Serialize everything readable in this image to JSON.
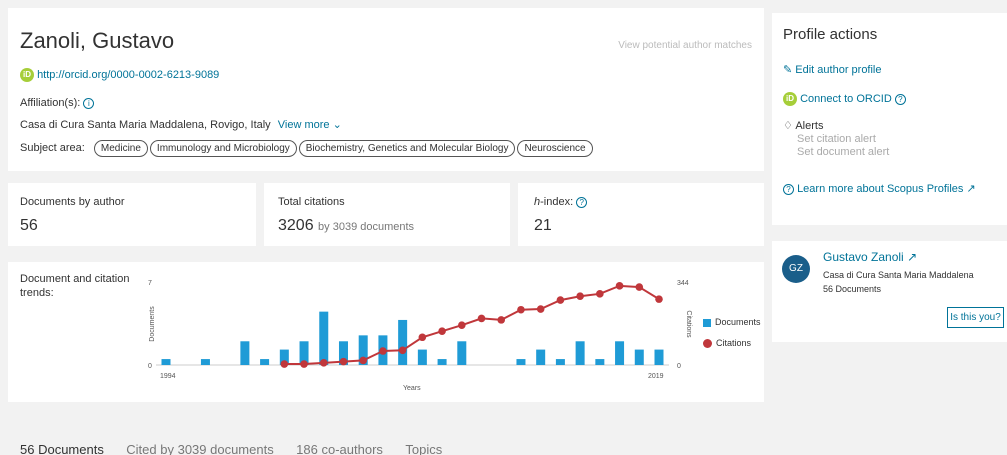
{
  "profile": {
    "name": "Zanoli, Gustavo",
    "view_matches": "View potential author matches",
    "orcid_url": "http://orcid.org/0000-0002-6213-9089",
    "affiliation_label": "Affiliation(s):",
    "affiliation": "Casa di Cura Santa Maria Maddalena, Rovigo, Italy",
    "view_more": "View more",
    "subject_label": "Subject area:",
    "subjects": [
      "Medicine",
      "Immunology and Microbiology",
      "Biochemistry, Genetics and Molecular Biology",
      "Neuroscience"
    ]
  },
  "metrics": {
    "documents_label": "Documents by author",
    "documents_value": "56",
    "citations_label": "Total citations",
    "citations_value": "3206",
    "citations_sub": "by 3039 documents",
    "hindex_label_h": "h",
    "hindex_label_rest": "-index:",
    "hindex_value": "21"
  },
  "trends": {
    "title": "Document and citation trends:",
    "legend_documents": "Documents",
    "legend_citations": "Citations",
    "color_documents": "#1f9bd6",
    "color_citations": "#c0373b"
  },
  "chart_data": {
    "type": "bar",
    "xlabel": "Years",
    "ylabel_left": "Documents",
    "ylabel_right": "Citations",
    "left_ticks": [
      "7",
      "0"
    ],
    "right_ticks": [
      "344",
      "0"
    ],
    "x_ticks": [
      "1994",
      "2019"
    ],
    "left_ylim": [
      0,
      7
    ],
    "right_ylim": [
      0,
      344
    ],
    "years": [
      1994,
      1995,
      1996,
      1997,
      1998,
      1999,
      2000,
      2001,
      2002,
      2003,
      2004,
      2005,
      2006,
      2007,
      2008,
      2009,
      2010,
      2011,
      2012,
      2013,
      2014,
      2015,
      2016,
      2017,
      2018,
      2019
    ],
    "series": [
      {
        "name": "Documents",
        "values": [
          0.5,
          0,
          0.5,
          0,
          2,
          0.5,
          1.3,
          2,
          4.5,
          2,
          2.5,
          2.5,
          3.8,
          1.3,
          0.5,
          2,
          0,
          0,
          0.5,
          1.3,
          0.5,
          2,
          0.5,
          2,
          1.3,
          1.3
        ]
      },
      {
        "name": "Citations",
        "values": [
          null,
          null,
          null,
          null,
          null,
          null,
          4,
          4,
          9,
          14,
          19,
          58,
          61,
          115,
          140,
          165,
          193,
          187,
          229,
          232,
          269,
          285,
          295,
          328,
          323,
          273
        ]
      }
    ]
  },
  "tabs": [
    "56 Documents",
    "Cited by 3039 documents",
    "186 co-authors",
    "Topics"
  ],
  "actions": {
    "title": "Profile actions",
    "edit": "Edit author profile",
    "orcid": "Connect to ORCID",
    "alerts": "Alerts",
    "citation_alert": "Set citation alert",
    "document_alert": "Set document alert",
    "learn": "Learn more about Scopus Profiles"
  },
  "suggestion": {
    "initials": "GZ",
    "name": "Gustavo Zanoli",
    "affiliation": "Casa di Cura Santa Maria Maddalena",
    "documents": "56 Documents",
    "button": "Is this you?"
  },
  "icons": {
    "orcid": "orcid-icon",
    "info": "info-icon",
    "edit": "edit-user-icon",
    "bell": "bell-icon",
    "arrow": "external-arrow-icon",
    "chevron": "chevron-down-icon"
  }
}
